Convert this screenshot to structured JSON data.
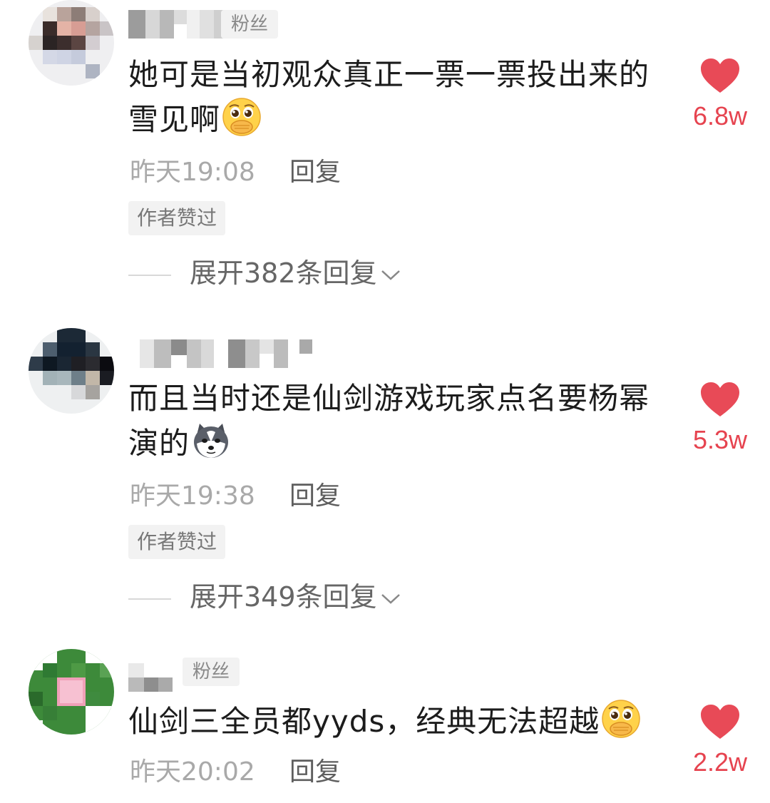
{
  "colors": {
    "like_red": "#e84a57",
    "like_count": "#e6434f",
    "meta_gray": "#a9a9a9",
    "text": "#1c1c1c"
  },
  "comments": [
    {
      "badge": "粉丝",
      "content": "她可是当初观众真正一票一票投出来的雪见啊",
      "emoji": "pleading-hand-over-mouth-emoji",
      "time": "昨天19:08",
      "reply_label": "回复",
      "author_liked": "作者赞过",
      "expand_label": "展开382条回复",
      "likes": "6.8w"
    },
    {
      "badge": "",
      "content": "而且当时还是仙剑游戏玩家点名要杨幂演的",
      "emoji": "husky-dog-emoji",
      "time": "昨天19:38",
      "reply_label": "回复",
      "author_liked": "作者赞过",
      "expand_label": "展开349条回复",
      "likes": "5.3w"
    },
    {
      "badge": "粉丝",
      "content": "仙剑三全员都yyds，经典无法超越",
      "emoji": "pleading-hand-over-mouth-emoji",
      "time": "昨天20:02",
      "reply_label": "回复",
      "likes": "2.2w"
    }
  ]
}
